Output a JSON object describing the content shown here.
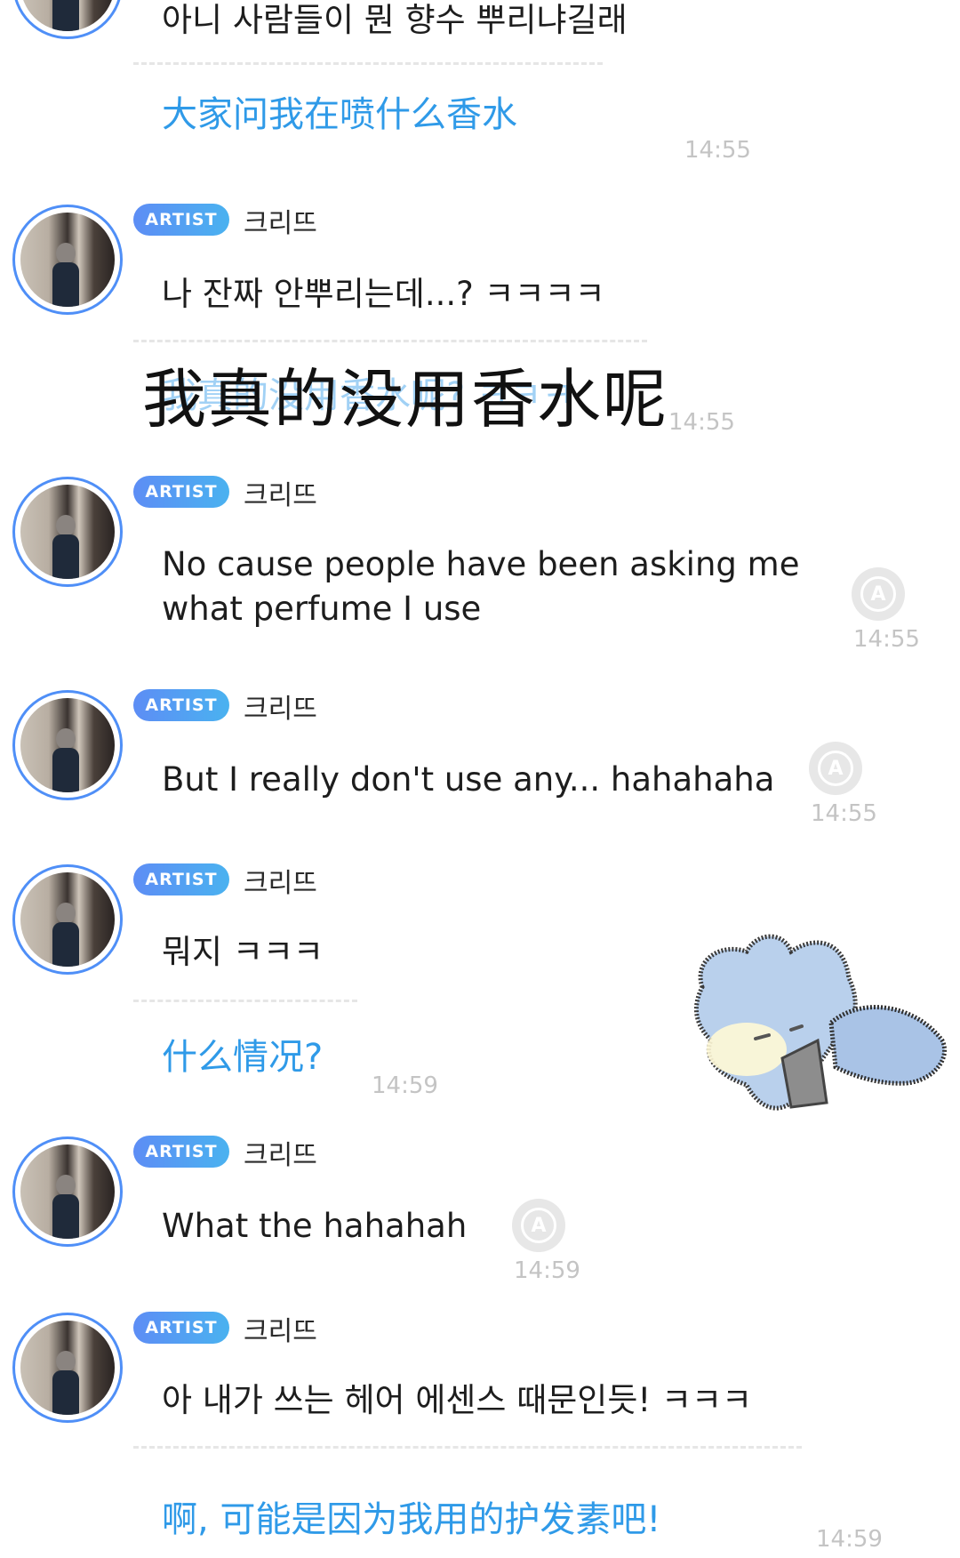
{
  "messages": [
    {
      "original": "아니 사람들이 뭔 향수 뿌리냐길래",
      "translation": "大家问我在喷什么香水",
      "time": "14:55"
    },
    {
      "badge": "ARTIST",
      "name": "크리뜨",
      "original": "나 잔짜 안뿌리는데...? ㅋㅋㅋㅋ",
      "translation": "我真的没用香水呢? ㅋㅋㅋ",
      "overlay": "我真的没用香水呢",
      "time": "14:55"
    },
    {
      "badge": "ARTIST",
      "name": "크리뜨",
      "original_line1": "No cause people have been asking me",
      "original_line2": "what perfume I use",
      "time": "14:55"
    },
    {
      "badge": "ARTIST",
      "name": "크리뜨",
      "original": "But I really don't use any... hahahaha",
      "time": "14:55"
    },
    {
      "badge": "ARTIST",
      "name": "크리뜨",
      "original": "뭐지 ㅋㅋㅋ",
      "translation": "什么情况?",
      "time": "14:59"
    },
    {
      "badge": "ARTIST",
      "name": "크리뜨",
      "original": "What the hahahah",
      "time": "14:59"
    },
    {
      "badge": "ARTIST",
      "name": "크리뜨",
      "original": "아 내가 쓰는 헤어 에센스 때문인듯! ㅋㅋㅋ",
      "translation": "啊, 可能是因为我用的护发素吧!",
      "time": "14:59"
    }
  ],
  "icons": {
    "translate": "translate-icon",
    "sticker": "cat-sticker"
  },
  "translate_icon_glyph": "A",
  "colors": {
    "accent": "#4f8ff7",
    "translation_text": "#2f9ae8",
    "timestamp": "#c4c4c4"
  }
}
